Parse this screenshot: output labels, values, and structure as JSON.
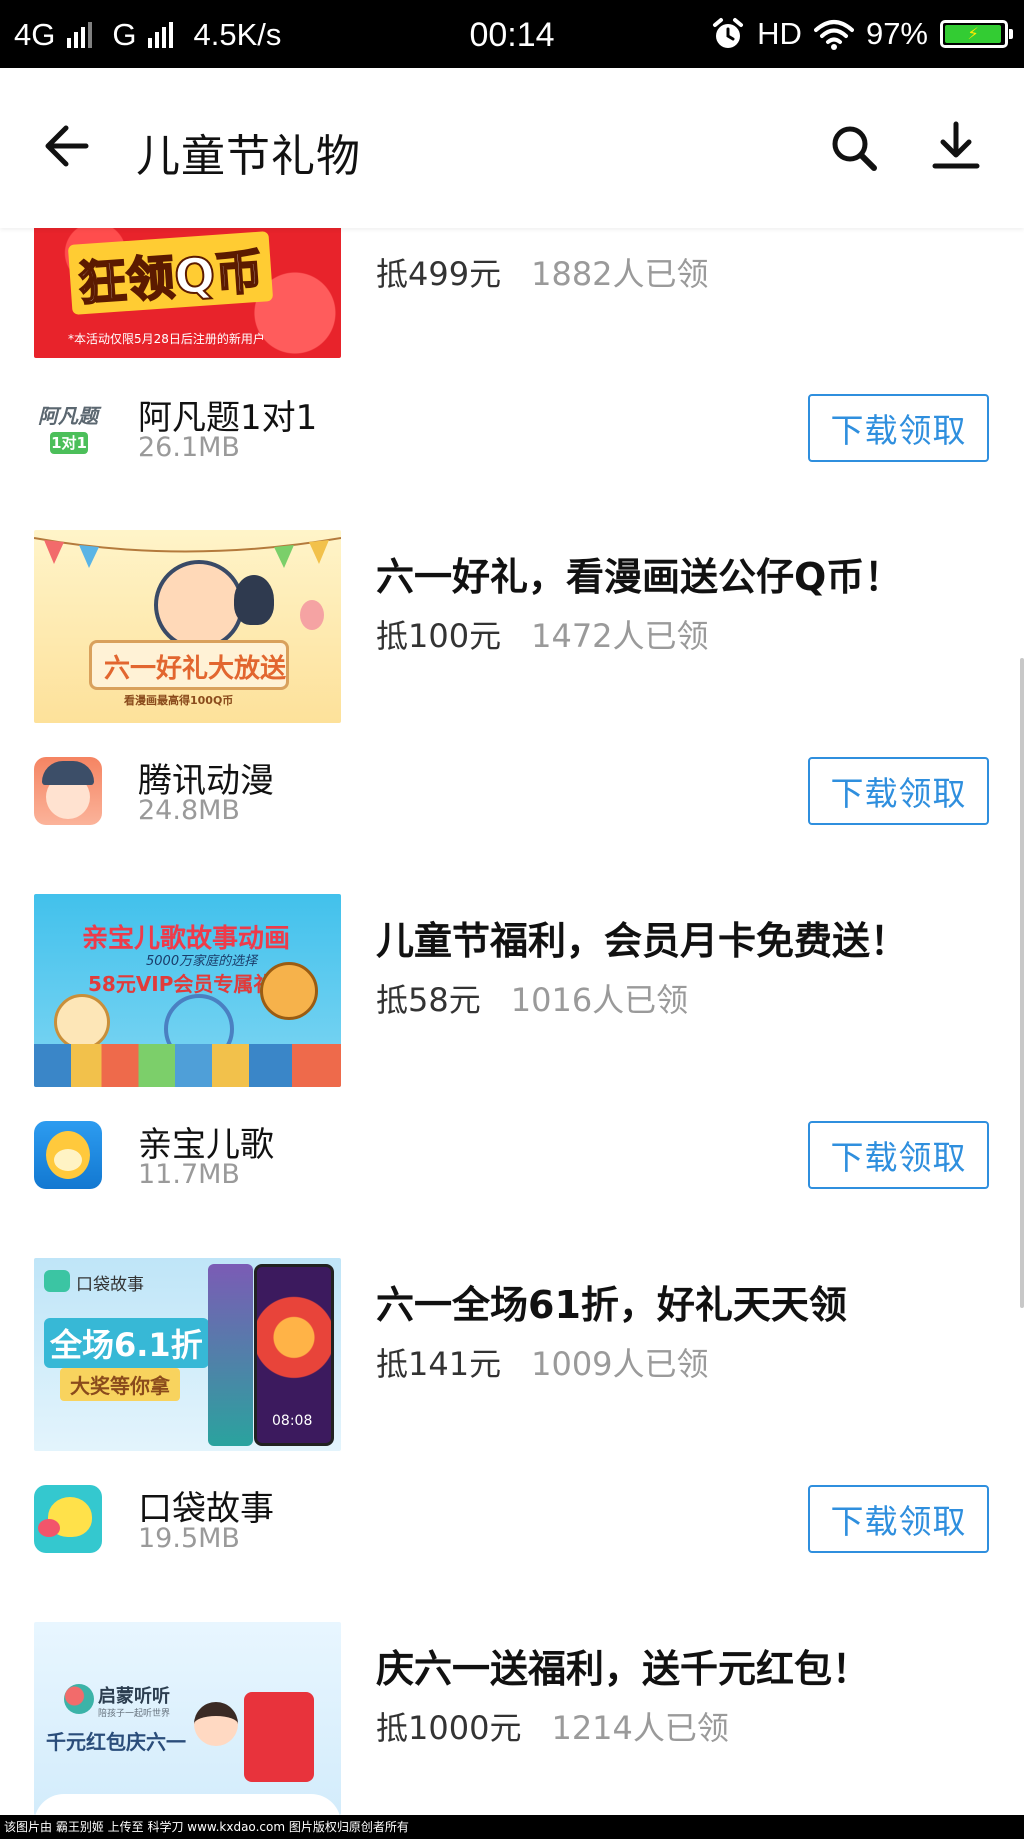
{
  "status_bar": {
    "network1": "4G",
    "network2": "G",
    "speed": "4.5K/s",
    "time": "00:14",
    "hd": "HD",
    "battery_pct": "97%",
    "battery_level": 0.97
  },
  "header": {
    "title": "儿童节礼物"
  },
  "promos": [
    {
      "banner_text": "狂领Q币",
      "banner_note": "*本活动仅限5月28日后注册的新用户",
      "title": "",
      "value": "抵499元",
      "claimed": "1882人已领",
      "app_icon_text": "阿凡题",
      "app_icon_badge": "1对1",
      "app_name": "阿凡题1对1",
      "app_size": "26.1MB",
      "button": "下载领取"
    },
    {
      "banner_text": "六一好礼大放送",
      "banner_note": "看漫画最高得100Q币",
      "title": "六一好礼，看漫画送公仔Q币！",
      "value": "抵100元",
      "claimed": "1472人已领",
      "app_name": "腾讯动漫",
      "app_size": "24.8MB",
      "button": "下载领取"
    },
    {
      "banner_text": "亲宝儿歌故事动画",
      "banner_sub": "5000万家庭的选择",
      "banner_note": "58元VIP会员专属礼包",
      "title": "儿童节福利，会员月卡免费送！",
      "value": "抵58元",
      "claimed": "1016人已领",
      "app_name": "亲宝儿歌",
      "app_size": "11.7MB",
      "button": "下载领取"
    },
    {
      "banner_brand": "口袋故事",
      "banner_text": "全场6.1折",
      "banner_note": "大奖等你拿",
      "phone_time": "08:08",
      "title": "六一全场61折，好礼天天领",
      "value": "抵141元",
      "claimed": "1009人已领",
      "app_name": "口袋故事",
      "app_size": "19.5MB",
      "button": "下载领取"
    },
    {
      "banner_brand": "启蒙听听",
      "banner_slogan": "陪孩子一起听世界",
      "banner_text": "千元红包庆六一",
      "title": "庆六一送福利，送千元红包！",
      "value": "抵1000元",
      "claimed": "1214人已领"
    }
  ],
  "footer": {
    "watermark": "该图片由 霸王别姬 上传至 科学刀 www.kxdao.com 图片版权归原创者所有"
  },
  "colors": {
    "accent_blue": "#2f8fde",
    "muted_gray": "#9a9a9a",
    "battery_green": "#33cc33"
  },
  "icons": [
    "back-arrow-icon",
    "search-icon",
    "download-icon",
    "alarm-icon",
    "wifi-icon",
    "battery-icon"
  ]
}
